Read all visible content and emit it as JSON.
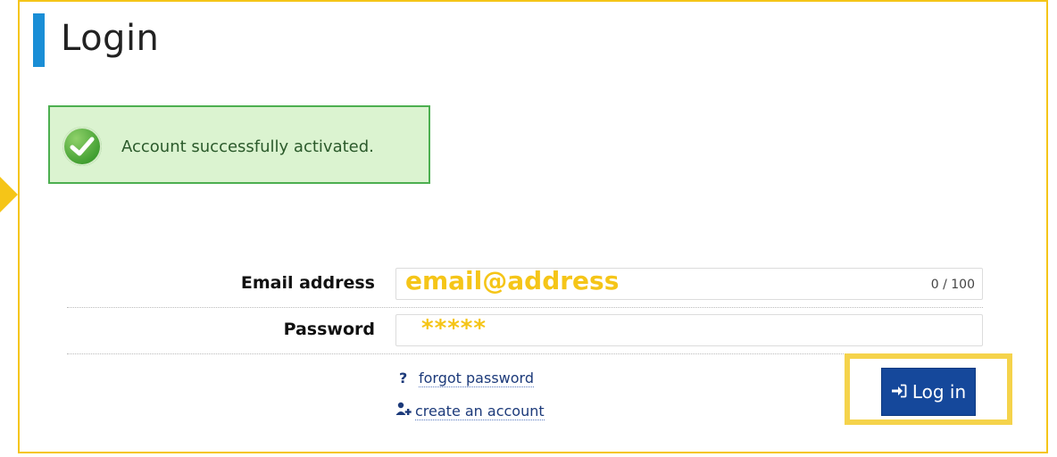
{
  "page": {
    "title": "Login"
  },
  "alert": {
    "message": "Account successfully activated.",
    "icon": "check-circle-icon"
  },
  "form": {
    "email_label": "Email address",
    "email_value": "email@address",
    "email_counter": "0 / 100",
    "password_label": "Password",
    "password_value": "*****"
  },
  "links": {
    "forgot_icon": "?",
    "forgot_label": "forgot password",
    "create_label": "create an account"
  },
  "actions": {
    "login_label": "Log in"
  },
  "colors": {
    "accent_blue": "#1a8ed6",
    "button_blue": "#15489b",
    "success_green": "#4caf50",
    "highlight_yellow": "#f5c518"
  }
}
